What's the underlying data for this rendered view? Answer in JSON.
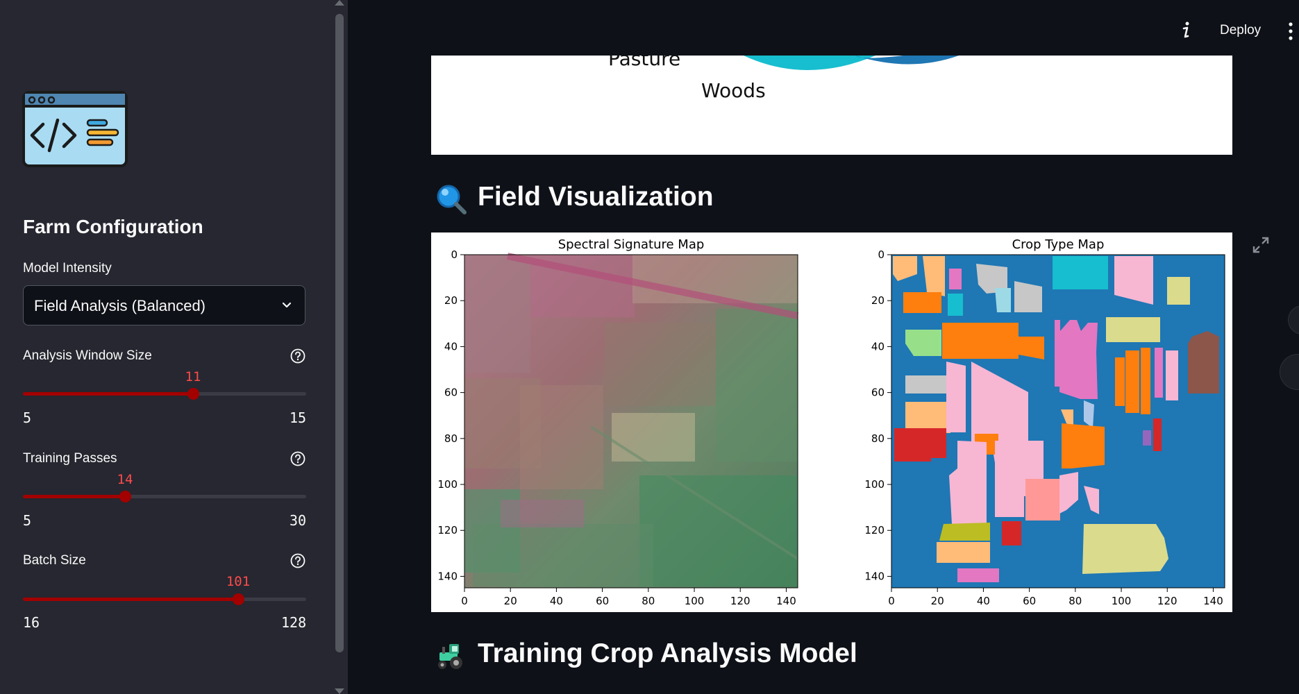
{
  "header": {
    "deploy_label": "Deploy",
    "info_icon": "info-icon",
    "menu_icon": "vertical-dots-icon"
  },
  "sidebar": {
    "logo_icon": "code-window-icon",
    "heading": "Farm Configuration",
    "model_intensity": {
      "label": "Model Intensity",
      "value": "Field Analysis (Balanced)"
    },
    "sliders": [
      {
        "label": "Analysis Window Size",
        "value": "11",
        "min": "5",
        "max": "15",
        "fraction": 0.6
      },
      {
        "label": "Training Passes",
        "value": "14",
        "min": "5",
        "max": "30",
        "fraction": 0.36
      },
      {
        "label": "Batch Size",
        "value": "101",
        "min": "16",
        "max": "128",
        "fraction": 0.759
      }
    ]
  },
  "main": {
    "pie_partial": {
      "labels": [
        "Pasture",
        "Woods"
      ],
      "colors": [
        "#17becf",
        "#1f77b4"
      ]
    },
    "field_section": {
      "icon": "magnifying-glass-icon",
      "title": "Field Visualization"
    },
    "training_section": {
      "icon": "tractor-icon",
      "title": "Training Crop Analysis Model"
    }
  },
  "chart_data": [
    {
      "type": "heatmap",
      "title": "Spectral Signature Map",
      "xticks": [
        "0",
        "20",
        "40",
        "60",
        "80",
        "100",
        "120",
        "140"
      ],
      "yticks": [
        "0",
        "20",
        "40",
        "60",
        "80",
        "100",
        "120",
        "140"
      ],
      "xlim": [
        0,
        145
      ],
      "ylim": [
        145,
        0
      ]
    },
    {
      "type": "heatmap",
      "title": "Crop Type Map",
      "xticks": [
        "0",
        "20",
        "40",
        "60",
        "80",
        "100",
        "120",
        "140"
      ],
      "yticks": [
        "0",
        "20",
        "40",
        "60",
        "80",
        "100",
        "120",
        "140"
      ],
      "xlim": [
        0,
        145
      ],
      "ylim": [
        145,
        0
      ],
      "background_color": "#1f77b4"
    }
  ]
}
